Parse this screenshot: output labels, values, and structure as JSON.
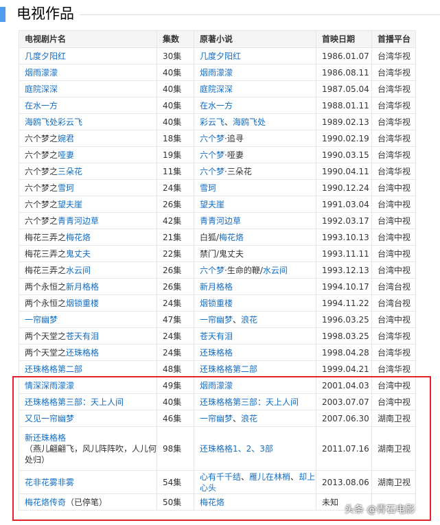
{
  "section": {
    "title": "电视作品"
  },
  "table": {
    "headers": [
      "电视剧片名",
      "集数",
      "原著小说",
      "首映日期",
      "首播平台"
    ],
    "rows": [
      {
        "title": [
          {
            "t": "几度夕阳红",
            "link": true
          }
        ],
        "episodes": "30集",
        "novel": [
          {
            "t": "几度夕阳红",
            "link": true
          }
        ],
        "date": "1986.01.07",
        "platform": "台湾华视"
      },
      {
        "title": [
          {
            "t": "烟雨濛濛",
            "link": true
          }
        ],
        "episodes": "40集",
        "novel": [
          {
            "t": "烟雨濛濛",
            "link": true
          }
        ],
        "date": "1986.08.11",
        "platform": "台湾华视"
      },
      {
        "title": [
          {
            "t": "庭院深深",
            "link": true
          }
        ],
        "episodes": "40集",
        "novel": [
          {
            "t": "庭院深深",
            "link": true
          }
        ],
        "date": "1987.05.04",
        "platform": "台湾华视"
      },
      {
        "title": [
          {
            "t": "在水一方",
            "link": true
          }
        ],
        "episodes": "40集",
        "novel": [
          {
            "t": "在水一方",
            "link": true
          }
        ],
        "date": "1988.01.11",
        "platform": "台湾华视"
      },
      {
        "title": [
          {
            "t": "海鸥飞处彩云飞",
            "link": true
          }
        ],
        "episodes": "40集",
        "novel": [
          {
            "t": "彩云飞",
            "link": true
          },
          {
            "t": "、",
            "link": false
          },
          {
            "t": "海鸥飞处",
            "link": true
          }
        ],
        "date": "1989.02.13",
        "platform": "台湾华视"
      },
      {
        "title": [
          {
            "t": "六个梦之",
            "link": false
          },
          {
            "t": "婉君",
            "link": true
          }
        ],
        "episodes": "18集",
        "novel": [
          {
            "t": "六个梦",
            "link": true
          },
          {
            "t": "·追寻",
            "link": false
          }
        ],
        "date": "1990.02.19",
        "platform": "台湾华视"
      },
      {
        "title": [
          {
            "t": "六个梦之",
            "link": false
          },
          {
            "t": "哑妻",
            "link": true
          }
        ],
        "episodes": "19集",
        "novel": [
          {
            "t": "六个梦",
            "link": true
          },
          {
            "t": "·哑妻",
            "link": false
          }
        ],
        "date": "1990.03.15",
        "platform": "台湾华视"
      },
      {
        "title": [
          {
            "t": "六个梦之",
            "link": false
          },
          {
            "t": "三朵花",
            "link": true
          }
        ],
        "episodes": "11集",
        "novel": [
          {
            "t": "六个梦",
            "link": true
          },
          {
            "t": "·三朵花",
            "link": false
          }
        ],
        "date": "1990.04.11",
        "platform": "台湾华视"
      },
      {
        "title": [
          {
            "t": "六个梦之",
            "link": false
          },
          {
            "t": "雪珂",
            "link": true
          }
        ],
        "episodes": "24集",
        "novel": [
          {
            "t": "雪珂",
            "link": true
          }
        ],
        "date": "1990.12.24",
        "platform": "台湾中视"
      },
      {
        "title": [
          {
            "t": "六个梦之",
            "link": false
          },
          {
            "t": "望夫崖",
            "link": true
          }
        ],
        "episodes": "26集",
        "novel": [
          {
            "t": "望夫崖",
            "link": true
          }
        ],
        "date": "1991.03.04",
        "platform": "台湾中视"
      },
      {
        "title": [
          {
            "t": "六个梦之",
            "link": false
          },
          {
            "t": "青青河边草",
            "link": true
          }
        ],
        "episodes": "42集",
        "novel": [
          {
            "t": "青青河边草",
            "link": true
          }
        ],
        "date": "1992.03.17",
        "platform": "台湾中视"
      },
      {
        "title": [
          {
            "t": "梅花三弄之",
            "link": false
          },
          {
            "t": "梅花烙",
            "link": true
          }
        ],
        "episodes": "21集",
        "novel": [
          {
            "t": "白狐/",
            "link": false
          },
          {
            "t": "梅花烙",
            "link": true
          }
        ],
        "date": "1993.10.13",
        "platform": "台湾中视"
      },
      {
        "title": [
          {
            "t": "梅花三弄之",
            "link": false
          },
          {
            "t": "鬼丈夫",
            "link": true
          }
        ],
        "episodes": "22集",
        "novel": [
          {
            "t": "禁门/鬼丈夫",
            "link": false
          }
        ],
        "date": "1993.11.11",
        "platform": "台湾中视"
      },
      {
        "title": [
          {
            "t": "梅花三弄之",
            "link": false
          },
          {
            "t": "水云间",
            "link": true
          }
        ],
        "episodes": "26集",
        "novel": [
          {
            "t": "六个梦",
            "link": true
          },
          {
            "t": "·生命的鞭/",
            "link": false
          },
          {
            "t": "水云间",
            "link": true
          }
        ],
        "date": "1993.12.13",
        "platform": "台湾中视"
      },
      {
        "title": [
          {
            "t": "两个永恒之",
            "link": false
          },
          {
            "t": "新月格格",
            "link": true
          }
        ],
        "episodes": "26集",
        "novel": [
          {
            "t": "新月格格",
            "link": true
          }
        ],
        "date": "1994.10.17",
        "platform": "台湾台视"
      },
      {
        "title": [
          {
            "t": "两个永恒之",
            "link": false
          },
          {
            "t": "烟锁重楼",
            "link": true
          }
        ],
        "episodes": "24集",
        "novel": [
          {
            "t": "烟锁重楼",
            "link": true
          }
        ],
        "date": "1994.11.22",
        "platform": "台湾台视"
      },
      {
        "title": [
          {
            "t": "一帘幽梦",
            "link": true
          }
        ],
        "episodes": "47集",
        "novel": [
          {
            "t": "一帘幽梦",
            "link": true
          },
          {
            "t": "、",
            "link": false
          },
          {
            "t": "浪花",
            "link": true
          }
        ],
        "date": "1996.03.25",
        "platform": "台湾中视"
      },
      {
        "title": [
          {
            "t": "两个天堂之",
            "link": false
          },
          {
            "t": "苍天有泪",
            "link": true
          }
        ],
        "episodes": "24集",
        "novel": [
          {
            "t": "苍天有泪",
            "link": true
          }
        ],
        "date": "1998.03.25",
        "platform": "台湾华视"
      },
      {
        "title": [
          {
            "t": "两个天堂之",
            "link": false
          },
          {
            "t": "还珠格格",
            "link": true
          }
        ],
        "episodes": "24集",
        "novel": [
          {
            "t": "还珠格格",
            "link": true
          }
        ],
        "date": "1998.04.28",
        "platform": "台湾华视"
      },
      {
        "title": [
          {
            "t": "还珠格格第二部",
            "link": true
          }
        ],
        "episodes": "48集",
        "novel": [
          {
            "t": "还珠格格第二部",
            "link": true
          }
        ],
        "date": "1999.04.21",
        "platform": "台湾华视"
      },
      {
        "title": [
          {
            "t": "情深深雨濛濛",
            "link": true
          }
        ],
        "episodes": "49集",
        "novel": [
          {
            "t": "烟雨濛濛",
            "link": true
          }
        ],
        "date": "2001.04.03",
        "platform": "台湾中视"
      },
      {
        "title": [
          {
            "t": "还珠格格第三部：天上人间",
            "link": true
          }
        ],
        "episodes": "40集",
        "novel": [
          {
            "t": "还珠格格第三部：天上人间",
            "link": true
          }
        ],
        "date": "2003.07.07",
        "platform": "台湾中视"
      },
      {
        "title": [
          {
            "t": "又见一帘幽梦",
            "link": true
          }
        ],
        "episodes": "46集",
        "novel": [
          {
            "t": "一帘幽梦",
            "link": true
          },
          {
            "t": "、",
            "link": false
          },
          {
            "t": "浪花",
            "link": true
          }
        ],
        "date": "2007.06.30",
        "platform": "湖南卫视"
      },
      {
        "title": [
          {
            "t": "新还珠格格",
            "link": true
          },
          {
            "t": "\n（燕儿翩翩飞，风儿阵阵吹，人儿何处归）",
            "link": false
          }
        ],
        "episodes": "98集",
        "novel": [
          {
            "t": "还珠格格1、2、3部",
            "link": true
          }
        ],
        "date": "2011.07.16",
        "platform": "湖南卫视",
        "size": "tall3"
      },
      {
        "title": [
          {
            "t": "花非花雾非雾",
            "link": true
          }
        ],
        "episodes": "54集",
        "novel": [
          {
            "t": "心有千千结",
            "link": true
          },
          {
            "t": "、",
            "link": false
          },
          {
            "t": "雁儿在林梢",
            "link": true
          },
          {
            "t": "、",
            "link": false
          },
          {
            "t": "却上心头",
            "link": true
          }
        ],
        "date": "2013.08.06",
        "platform": "湖南卫视",
        "size": "tall2"
      },
      {
        "title": [
          {
            "t": "梅花烙传奇",
            "link": true
          },
          {
            "t": "（已停笔）",
            "link": false
          }
        ],
        "episodes": "50集",
        "novel": [
          {
            "t": "梅花烙",
            "link": true
          }
        ],
        "date": "未知",
        "platform": ""
      }
    ]
  },
  "watermark": "头条 @青石电影"
}
